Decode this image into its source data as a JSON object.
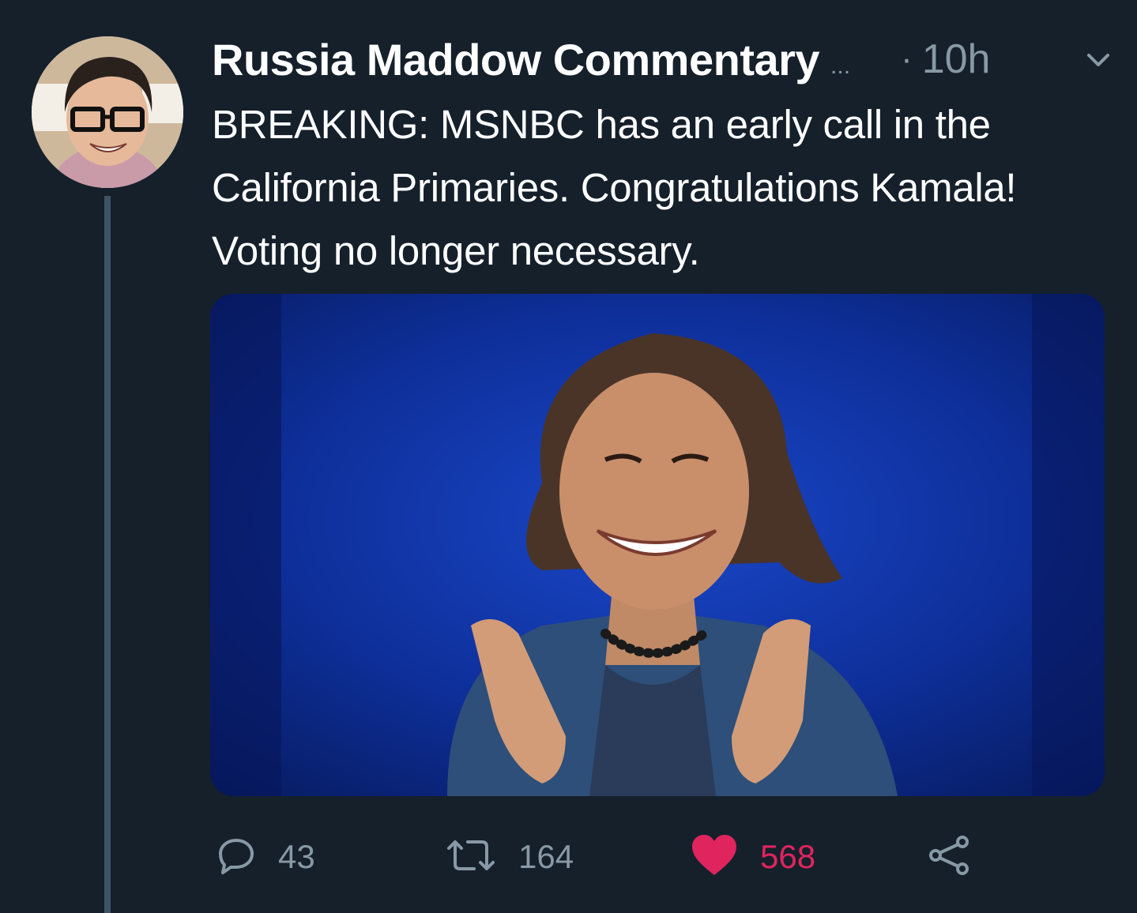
{
  "tweet": {
    "display_name": "Russia Maddow Commentary",
    "name_truncation": "...",
    "separator": "·",
    "timestamp": "10h",
    "text": "BREAKING: MSNBC has an early call in the California Primaries. Congratulations Kamala! Voting no longer necessary."
  },
  "actions": {
    "reply_count": "43",
    "retweet_count": "164",
    "like_count": "568",
    "liked": true
  },
  "icons": {
    "reply": "reply-icon",
    "retweet": "retweet-icon",
    "like": "heart-icon",
    "share": "share-icon",
    "menu": "chevron-down-icon"
  },
  "colors": {
    "background": "#15202b",
    "secondary_text": "#8899a6",
    "like_accent": "#e0245e",
    "thread_line": "#3d5466"
  }
}
